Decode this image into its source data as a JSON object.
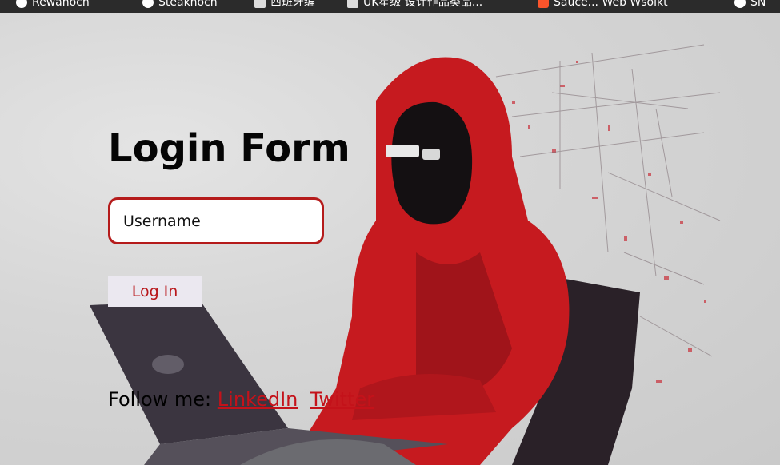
{
  "bookmarks": [
    {
      "label": "Rewahoch",
      "icon": "globe-icon"
    },
    {
      "label": "Steakhoch",
      "icon": "leaf-icon"
    },
    {
      "label": "西班牙编",
      "icon": "tag-icon"
    },
    {
      "label": "UK星级 设计作品类品...",
      "icon": "folder-icon"
    },
    {
      "label": "Sauce... Web Wsoikt",
      "icon": "brave-icon"
    },
    {
      "label": "SN",
      "icon": "globe-icon"
    }
  ],
  "form": {
    "title": "Login Form",
    "username_placeholder": "Username",
    "username_value": "",
    "login_label": "Log In",
    "accent": "#b51b1b"
  },
  "footer": {
    "follow_label": "Follow me: ",
    "links": [
      {
        "label": "LinkedIn"
      },
      {
        "label": "Twitter"
      }
    ]
  }
}
